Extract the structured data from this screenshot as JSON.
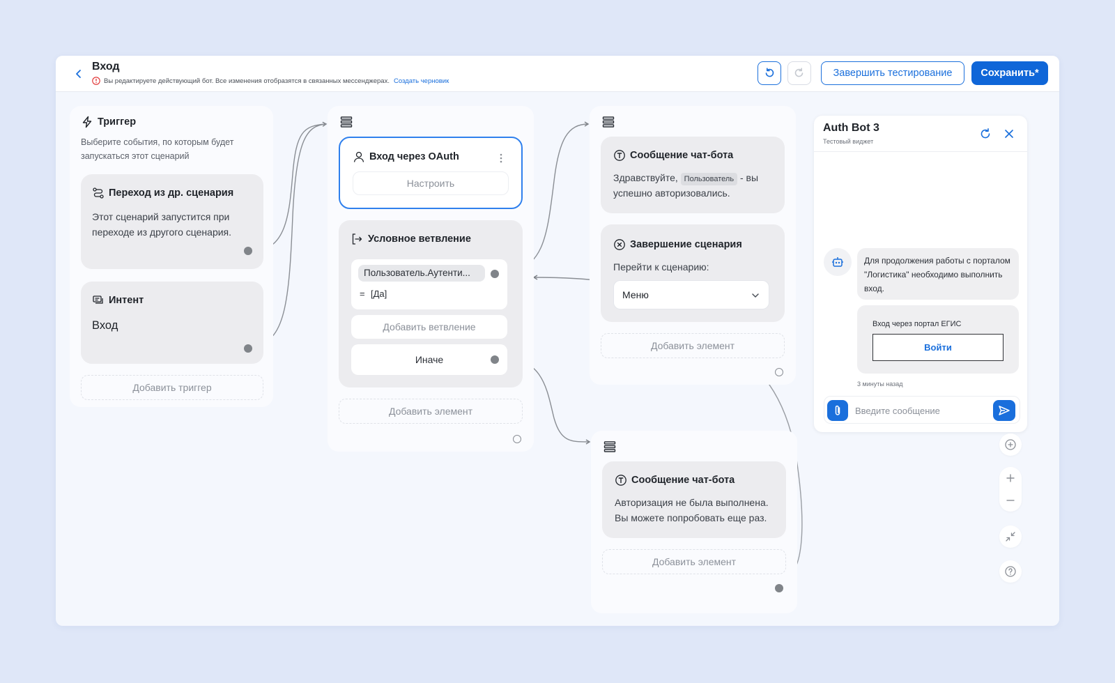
{
  "header": {
    "title": "Вход",
    "warning": "Вы редактируете действующий бот. Все изменения отобразятся в связанных мессенджерах.",
    "draft_link": "Создать черновик",
    "finish_label": "Завершить тестирование",
    "save_label": "Сохранить*"
  },
  "trigger": {
    "title": "Триггер",
    "description": "Выберите события, по которым будет запускаться этот сценарий",
    "cards": [
      {
        "title": "Переход из др. сценария",
        "text": "Этот сценарий запустится при переходе из другого сценария."
      },
      {
        "title": "Интент",
        "text": "Вход"
      }
    ],
    "add_label": "Добавить триггер"
  },
  "step1": {
    "oauth": {
      "title": "Вход через OAuth",
      "configure_label": "Настроить"
    },
    "branch": {
      "title": "Условное ветвление",
      "condition_var": "Пользователь.Аутенти...",
      "condition_eq": "=",
      "condition_value": "[Да]",
      "add_branch_label": "Добавить ветвление",
      "else_label": "Иначе"
    },
    "add_element_label": "Добавить элемент"
  },
  "step2": {
    "message": {
      "title": "Сообщение чат-бота",
      "text_before": "Здравствуйте,",
      "tag": "Пользователь",
      "text_after": "- вы успешно авторизовались."
    },
    "finish": {
      "title": "Завершение сценария",
      "label": "Перейти к сценарию:",
      "select_value": "Меню"
    },
    "add_element_label": "Добавить элемент"
  },
  "step3": {
    "message": {
      "title": "Сообщение чат-бота",
      "text": "Авторизация не была выполнена. Вы можете попробовать еще раз."
    },
    "add_element_label": "Добавить элемент"
  },
  "widget": {
    "title": "Auth Bot 3",
    "subtitle": "Тестовый виджет",
    "bot_message": "Для продолжения работы с порталом \"Логистика\" необходимо выполнить вход.",
    "login_caption": "Вход через портал ЕГИС",
    "login_button": "Войти",
    "timestamp": "3 минуты назад",
    "input_placeholder": "Введите сообщение"
  },
  "colors": {
    "accent": "#1a6fdc",
    "save_bg": "#0f66d8",
    "card_bg": "#ececef",
    "canvas_bg": "#f4f7fd"
  }
}
